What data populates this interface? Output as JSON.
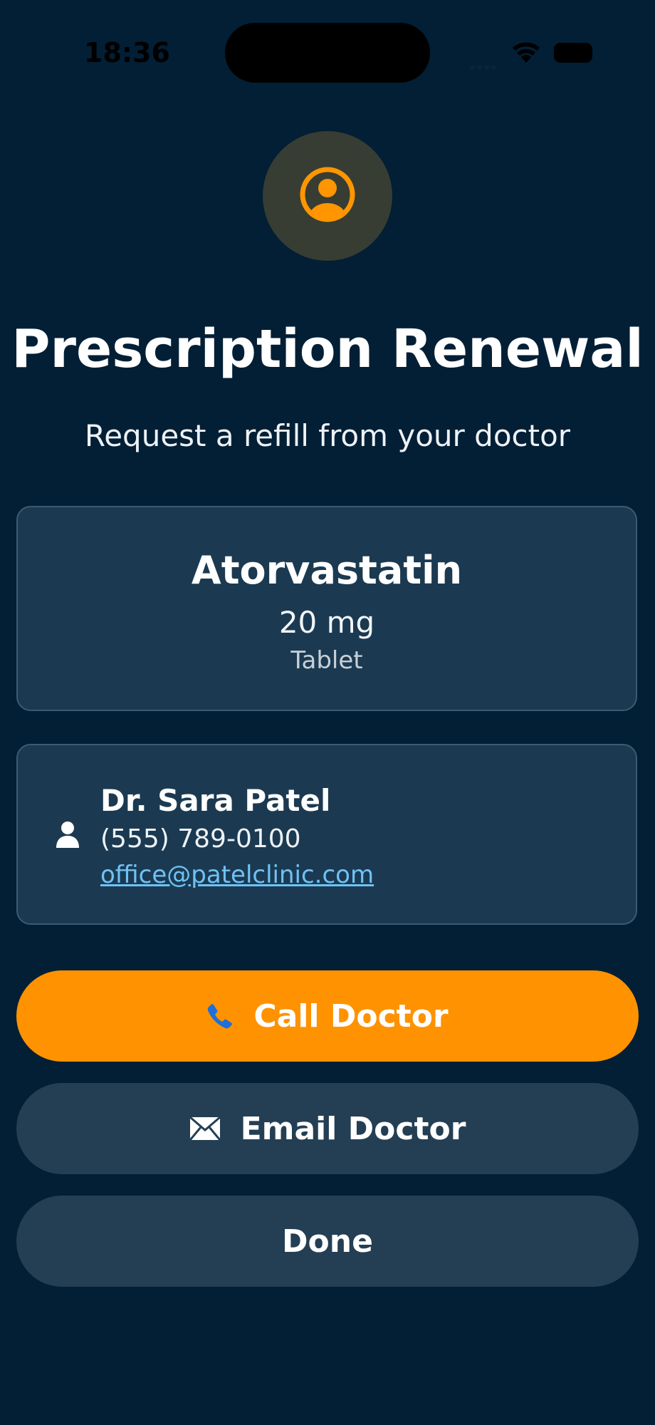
{
  "status_bar": {
    "time": "18:36"
  },
  "header": {
    "avatar_icon": "user-circle-icon",
    "title": "Prescription Renewal",
    "subtitle": "Request a refill from your doctor"
  },
  "medication": {
    "name": "Atorvastatin",
    "dose": "20 mg",
    "form": "Tablet"
  },
  "doctor": {
    "icon": "person-icon",
    "name": "Dr. Sara Patel",
    "phone": "(555) 789-0100",
    "email": "office@patelclinic.com"
  },
  "actions": {
    "call_label": "Call Doctor",
    "call_icon": "phone-icon",
    "email_label": "Email Doctor",
    "email_icon": "envelope-icon",
    "done_label": "Done"
  },
  "colors": {
    "background": "#021f35",
    "card": "#1b3a51",
    "accent": "#ff9200",
    "secondary_button": "#243f54",
    "link": "#6fc2f5"
  }
}
